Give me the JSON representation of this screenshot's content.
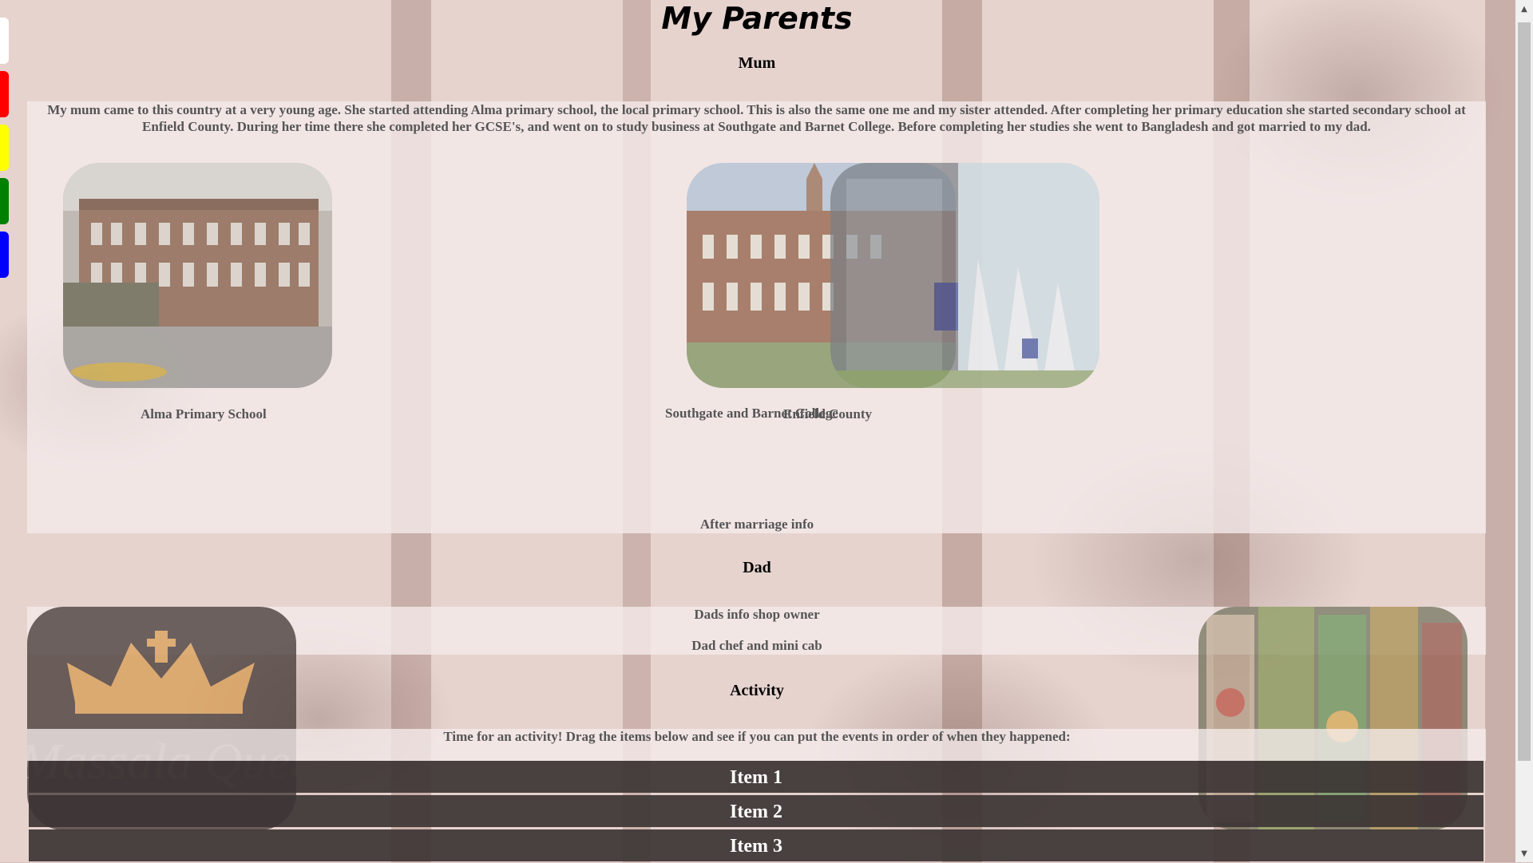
{
  "page_title": "My Parents",
  "mum": {
    "heading": "Mum",
    "paragraph": "My mum came to this country at a very young age. She started attending Alma primary school, the local primary school. This is also the same one me and my sister attended. After completing her primary education she started secondary school at Enfield County. During her time there she completed her GCSE's, and went on to study business at Southgate and Barnet College. Before completing her studies she went to Bangladesh and got married to my dad.",
    "photos": [
      {
        "caption": "Alma Primary School"
      },
      {
        "caption": "Southgate and Barnet College"
      },
      {
        "caption": "Enfield County"
      }
    ],
    "after_marriage": "After marriage info"
  },
  "dad": {
    "heading": "Dad",
    "line1": "Dads info shop owner",
    "line2": "Dad chef and mini cab",
    "logo_text": "Massala Queen"
  },
  "activity": {
    "heading": "Activity",
    "instruction": "Time for an activity! Drag the items below and see if you can put the events in order of when they happened:",
    "items": [
      "Item 1",
      "Item 2",
      "Item 3"
    ]
  },
  "side_tab_colors": [
    "#ffffff",
    "#ff0000",
    "#ffff00",
    "#008000",
    "#0000ff"
  ],
  "scrollbar": {
    "up_icon": "▲",
    "down_icon": "▼"
  }
}
